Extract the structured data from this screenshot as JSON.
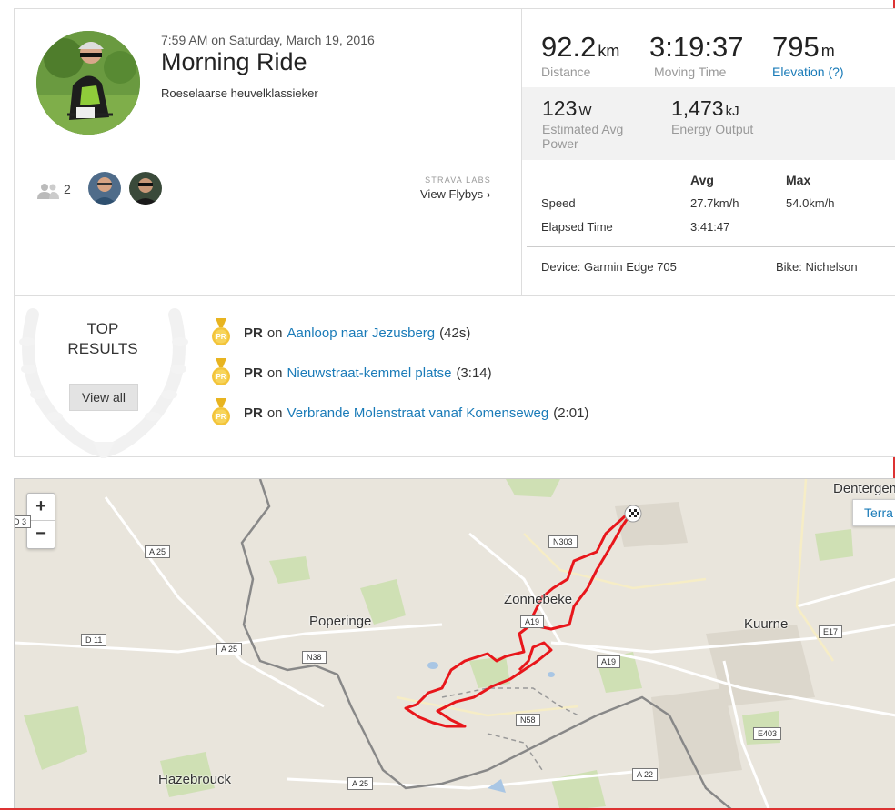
{
  "activity": {
    "datetime": "7:59 AM on Saturday, March 19, 2016",
    "title": "Morning Ride",
    "description": "Roeselaarse heuvelklassieker",
    "athlete_count": "2",
    "labs_label": "STRAVA LABS",
    "flyby_label": "View Flybys",
    "flyby_chevron": "›"
  },
  "stats": {
    "distance": {
      "value": "92.2",
      "unit": "km",
      "label": "Distance"
    },
    "moving_time": {
      "value": "3:19:37",
      "label": "Moving Time"
    },
    "elevation": {
      "value": "795",
      "unit": "m",
      "label": "Elevation (?)"
    },
    "power": {
      "value": "123",
      "unit": "W",
      "label_line1": "Estimated Avg",
      "label_line2": "Power"
    },
    "energy": {
      "value": "1,473",
      "unit": "kJ",
      "label": "Energy Output"
    }
  },
  "table": {
    "headers": [
      "Avg",
      "Max"
    ],
    "rows": [
      {
        "label": "Speed",
        "avg": "27.7km/h",
        "max": "54.0km/h"
      },
      {
        "label": "Elapsed Time",
        "avg": "3:41:47",
        "max": ""
      }
    ],
    "device": "Device: Garmin Edge 705",
    "bike": "Bike: Nichelson"
  },
  "top_results": {
    "title_line1": "TOP",
    "title_line2": "RESULTS",
    "view_all": "View all",
    "medal_text": "PR",
    "items": [
      {
        "badge": "PR",
        "on": "on",
        "segment": "Aanloop naar Jezusberg",
        "time": "(42s)"
      },
      {
        "badge": "PR",
        "on": "on",
        "segment": "Nieuwstraat-kemmel platse",
        "time": "(3:14)"
      },
      {
        "badge": "PR",
        "on": "on",
        "segment": "Verbrande Molenstraat vanaf Komenseweg",
        "time": "(2:01)"
      }
    ]
  },
  "map": {
    "zoom_in": "+",
    "zoom_out": "−",
    "terrain": "Terra",
    "places": [
      "Poperinge",
      "Zonnebeke",
      "Kuurne",
      "Hazebrouck",
      "Dentergem"
    ],
    "road_labels": [
      "A 25",
      "A 25",
      "A 25",
      "D 11",
      "N38",
      "N303",
      "A19",
      "A19",
      "N58",
      "E17",
      "E403",
      "A 22",
      "D 3"
    ],
    "route_color": "#e8161b"
  }
}
